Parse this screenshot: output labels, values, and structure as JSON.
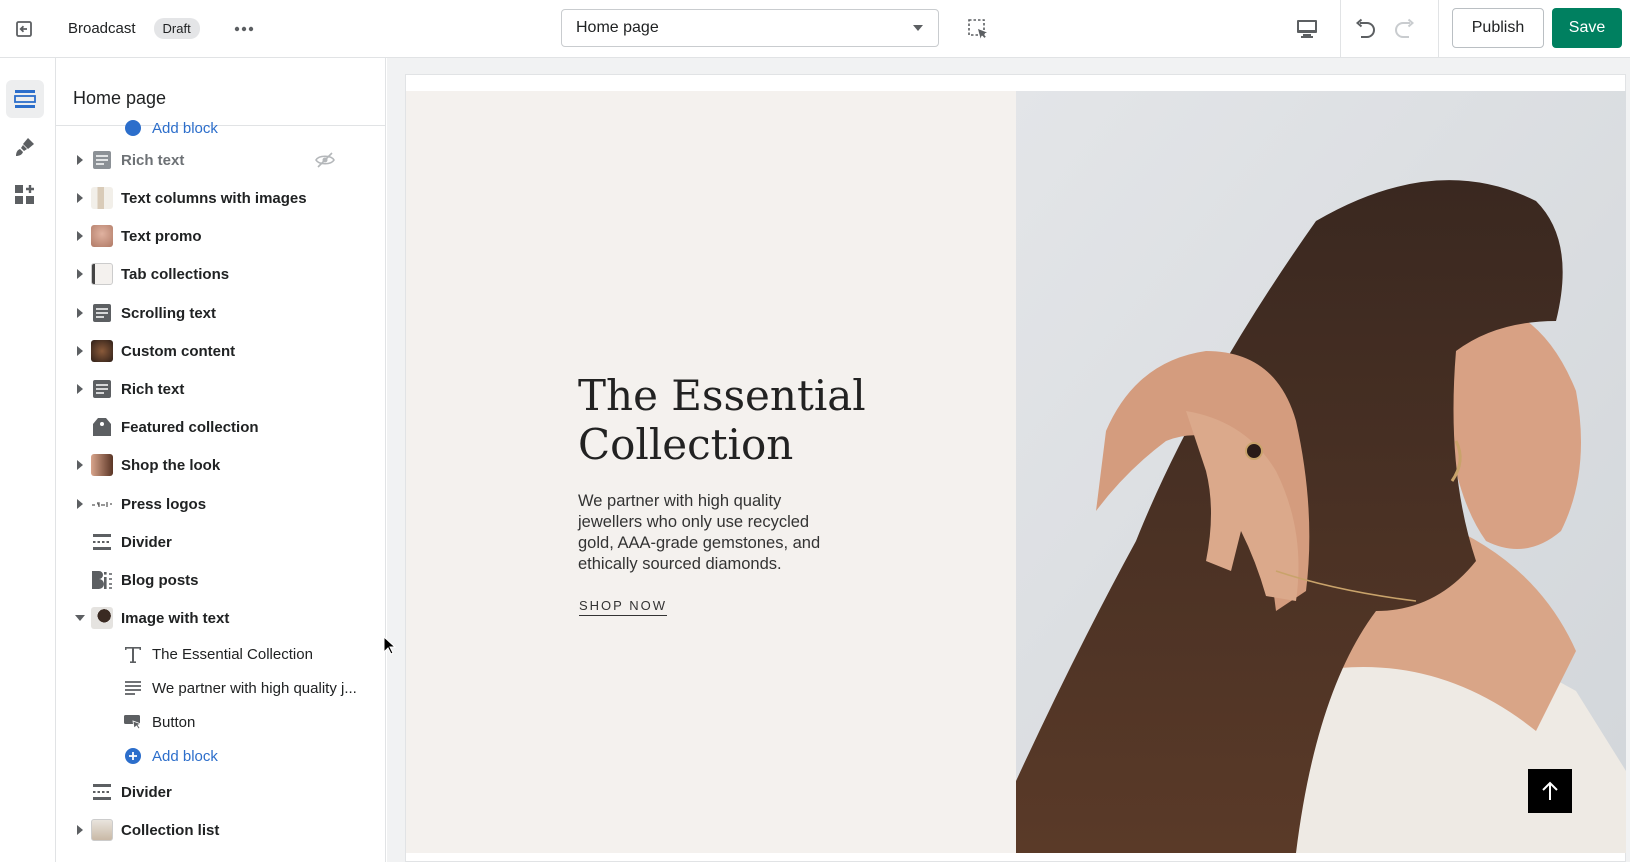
{
  "topbar": {
    "theme_name": "Broadcast",
    "status_badge": "Draft",
    "page_selector_value": "Home page",
    "publish_label": "Publish",
    "save_label": "Save"
  },
  "rail": {
    "items": [
      "sections-icon",
      "theme-settings-icon",
      "app-embeds-icon"
    ],
    "active_index": 0
  },
  "sidebar": {
    "title": "Home page",
    "partial_item": "Add block",
    "sections": [
      {
        "label": "Rich text",
        "icon": "text-icon",
        "expandable": true,
        "hidden": true
      },
      {
        "label": "Text columns with images",
        "icon": "thumbnail",
        "expandable": true
      },
      {
        "label": "Text promo",
        "icon": "thumbnail",
        "expandable": true
      },
      {
        "label": "Tab collections",
        "icon": "thumbnail",
        "expandable": true
      },
      {
        "label": "Scrolling text",
        "icon": "text-icon",
        "expandable": true
      },
      {
        "label": "Custom content",
        "icon": "thumbnail",
        "expandable": true
      },
      {
        "label": "Rich text",
        "icon": "text-icon",
        "expandable": true
      },
      {
        "label": "Featured collection",
        "icon": "tag-icon",
        "expandable": false
      },
      {
        "label": "Shop the look",
        "icon": "thumbnail",
        "expandable": true
      },
      {
        "label": "Press logos",
        "icon": "thumbnail",
        "expandable": true
      },
      {
        "label": "Divider",
        "icon": "divider-icon",
        "expandable": false
      },
      {
        "label": "Blog posts",
        "icon": "blog-icon",
        "expandable": false
      },
      {
        "label": "Image with text",
        "icon": "thumbnail",
        "expandable": true,
        "expanded": true
      }
    ],
    "blocks": [
      {
        "label": "The Essential Collection",
        "icon": "heading-icon"
      },
      {
        "label": "We partner with high quality j...",
        "icon": "paragraph-icon"
      },
      {
        "label": "Button",
        "icon": "button-icon"
      },
      {
        "label": "Add block",
        "icon": "add-circle-icon",
        "link": true
      }
    ],
    "after_sections": [
      {
        "label": "Divider",
        "icon": "divider-icon",
        "expandable": false
      },
      {
        "label": "Collection list",
        "icon": "thumbnail",
        "expandable": true
      }
    ]
  },
  "preview": {
    "heading": "The Essential Collection",
    "body": "We partner with high quality jewellers who only use recycled gold, AAA-grade gemstones, and ethically sourced diamonds.",
    "link": "SHOP NOW"
  },
  "colors": {
    "primary_green": "#008060",
    "link_blue": "#2c6ecb",
    "hero_bg": "#f4f1ee"
  }
}
